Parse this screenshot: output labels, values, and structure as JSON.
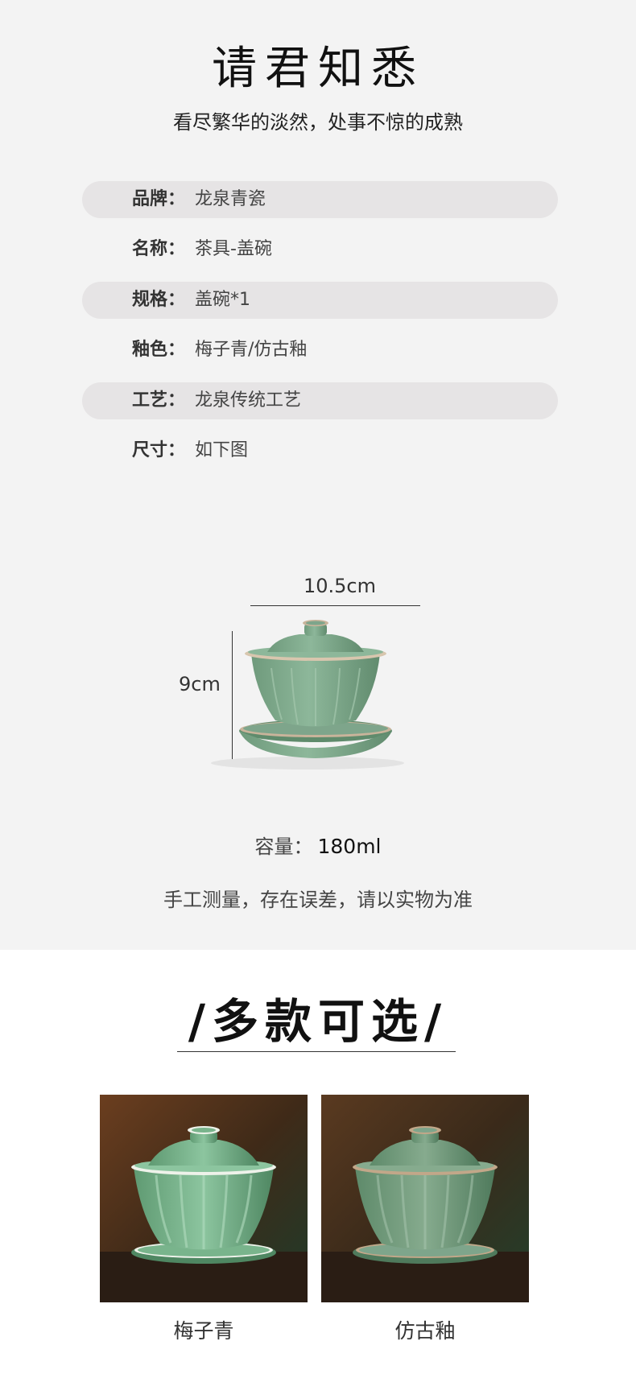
{
  "header": {
    "title": "请君知悉",
    "subtitle": "看尽繁华的淡然，处事不惊的成熟"
  },
  "specs": [
    {
      "label": "品牌：",
      "value": "龙泉青瓷"
    },
    {
      "label": "名称：",
      "value": "茶具-盖碗"
    },
    {
      "label": "规格：",
      "value": "盖碗*1"
    },
    {
      "label": "釉色：",
      "value": "梅子青/仿古釉"
    },
    {
      "label": "工艺：",
      "value": "龙泉传统工艺"
    },
    {
      "label": "尺寸：",
      "value": "如下图"
    }
  ],
  "dimensions": {
    "width_label": "10.5cm",
    "height_label": "9cm"
  },
  "capacity": {
    "label": "容量：",
    "value": "180ml"
  },
  "note": "手工测量，存在误差，请以实物为准",
  "variants_section": {
    "title": "/多款可选/",
    "items": [
      {
        "name": "梅子青",
        "glaze_color": "#7fae8a"
      },
      {
        "name": "仿古釉",
        "glaze_color": "#8aa78c"
      }
    ]
  },
  "colors": {
    "background_top": "#f3f3f3",
    "row_shade": "#e6e4e5",
    "celadon": "#7ea58b"
  }
}
